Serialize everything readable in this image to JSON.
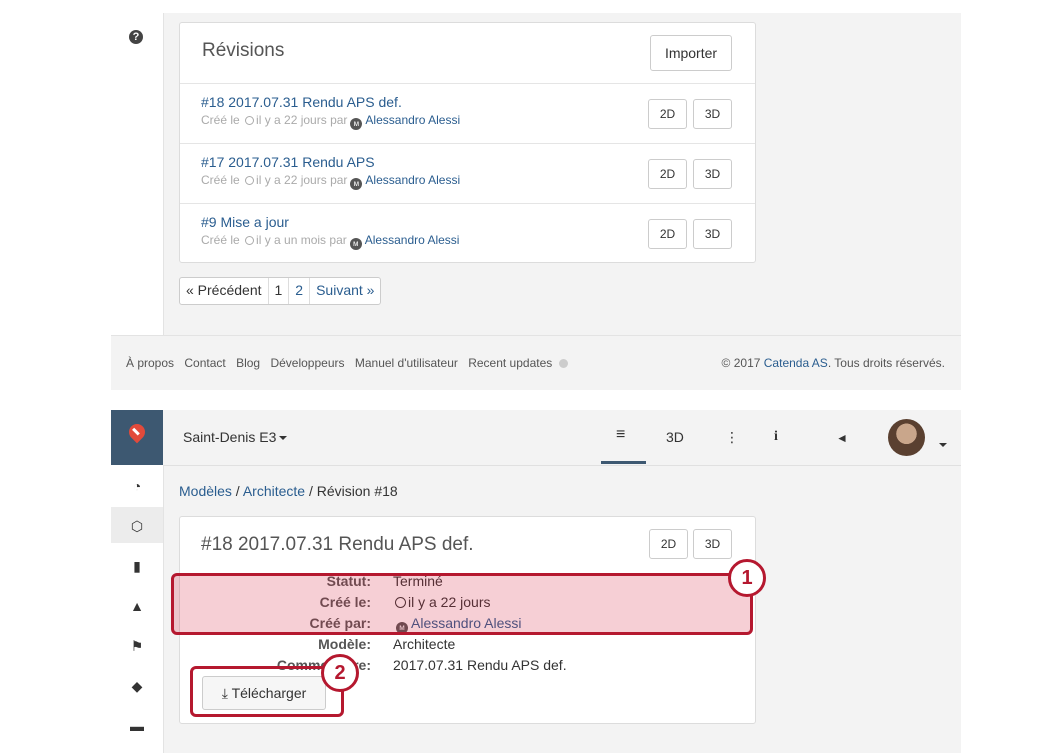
{
  "top": {
    "panel_title": "Révisions",
    "import_label": "Importer",
    "revisions": [
      {
        "title": "#18 2017.07.31 Rendu APS def.",
        "created_prefix": "Créé le",
        "when": "il y a 22 jours",
        "by": "par",
        "author": "Alessandro Alessi"
      },
      {
        "title": "#17 2017.07.31 Rendu APS",
        "created_prefix": "Créé le",
        "when": "il y a 22 jours",
        "by": "par",
        "author": "Alessandro Alessi"
      },
      {
        "title": "#9 Mise a jour",
        "created_prefix": "Créé le",
        "when": "il y a un mois",
        "by": "par",
        "author": "Alessandro Alessi"
      }
    ],
    "btn_2d": "2D",
    "btn_3d": "3D",
    "pager": {
      "prev": "« Précédent",
      "p1": "1",
      "p2": "2",
      "next": "Suivant »"
    },
    "footer": {
      "links": [
        "À propos",
        "Contact",
        "Blog",
        "Développeurs",
        "Manuel d'utilisateur",
        "Recent updates"
      ],
      "copyright_prefix": "© 2017",
      "company": "Catenda AS",
      "copyright_suffix": ". Tous droits réservés."
    }
  },
  "bottom": {
    "project": "Saint-Denis E3",
    "nav": {
      "list_icon": "≡",
      "three_d": "3D",
      "tree_icon": "⋮",
      "info": "i",
      "megaphone": "◄"
    },
    "breadcrumb": {
      "models": "Modèles",
      "sep": " / ",
      "architect": "Architecte",
      "current": "Révision #18"
    },
    "revision_title": "#18 2017.07.31 Rendu APS def.",
    "btn_2d": "2D",
    "btn_3d": "3D",
    "details": [
      {
        "label": "Statut:",
        "value": "Terminé"
      },
      {
        "label": "Créé le:",
        "value": "il y a 22 jours"
      },
      {
        "label": "Créé par:",
        "value": "Alessandro Alessi"
      },
      {
        "label": "Modèle:",
        "value": "Architecte"
      },
      {
        "label": "Commentaire:",
        "value": "2017.07.31 Rendu APS def."
      }
    ],
    "download_label": "Télécharger"
  },
  "annotations": {
    "badge_1": "1",
    "badge_2": "2"
  },
  "colors": {
    "accent": "#b5182f",
    "sidebar_brand": "#3d5871",
    "link": "#2a5d8f"
  }
}
